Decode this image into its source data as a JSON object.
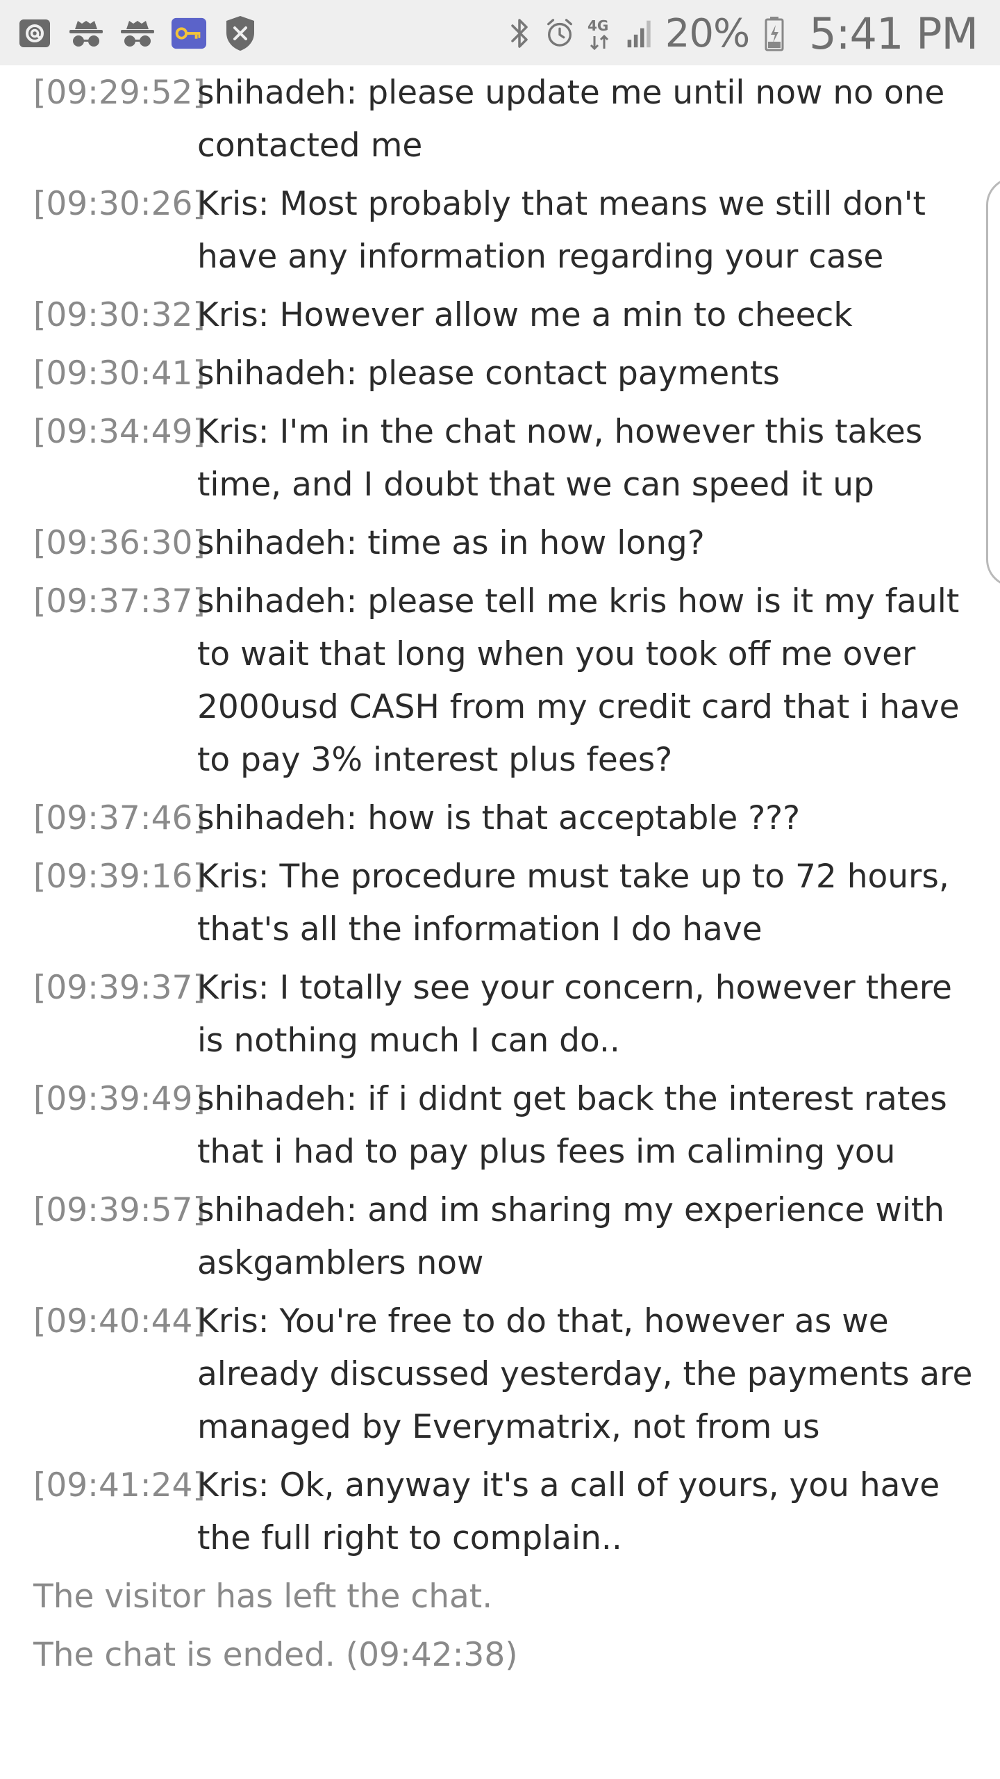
{
  "status_bar": {
    "left_icons": [
      "at-sign-icon",
      "incognito-icon",
      "incognito-icon",
      "key-icon",
      "shield-close-icon"
    ],
    "right_icons": [
      "bluetooth-icon",
      "alarm-icon",
      "network-4g-icon",
      "signal-icon",
      "battery-icon"
    ],
    "battery_percent": "20%",
    "time": "5:41 PM"
  },
  "messages": [
    {
      "ts": "[09:29:52]",
      "text": "shihadeh: please update me until now no one contacted me"
    },
    {
      "ts": "[09:30:26]",
      "text": "Kris: Most probably that means we still don't have any information regarding your case"
    },
    {
      "ts": "[09:30:32]",
      "text": "Kris: However allow me a min to cheeck"
    },
    {
      "ts": "[09:30:41]",
      "text": "shihadeh: please contact payments"
    },
    {
      "ts": "[09:34:49]",
      "text": "Kris: I'm in the chat now, however this takes time, and I doubt that we can speed it up"
    },
    {
      "ts": "[09:36:30]",
      "text": "shihadeh: time as in how long?"
    },
    {
      "ts": "[09:37:37]",
      "text": "shihadeh: please tell me kris how is it my fault to wait that long when you took off me over 2000usd CASH from my credit card that i have to pay 3% interest plus fees?"
    },
    {
      "ts": "[09:37:46]",
      "text": "shihadeh: how is that acceptable ???"
    },
    {
      "ts": "[09:39:16]",
      "text": "Kris: The procedure must take up to 72 hours, that's all the information I do have"
    },
    {
      "ts": "[09:39:37]",
      "text": "Kris: I totally see your concern, however there is nothing much I can do.."
    },
    {
      "ts": "[09:39:49]",
      "text": "shihadeh: if i didnt get back the interest rates that i had to pay plus fees im caliming you"
    },
    {
      "ts": "[09:39:57]",
      "text": "shihadeh: and im sharing my experience with askgamblers now"
    },
    {
      "ts": "[09:40:44]",
      "text": "Kris: You're free to do that, however as we already discussed yesterday, the payments are managed by Everymatrix, not from us"
    },
    {
      "ts": "[09:41:24]",
      "text": "Kris: Ok, anyway it's a call of yours, you have the full right to complain.."
    }
  ],
  "system_messages": [
    "The visitor has left the chat.",
    "The chat is ended. (09:42:38)"
  ],
  "colors": {
    "status_bar_bg": "#efefef",
    "timestamp": "#8a8a8a",
    "message_text": "#2b2b2b",
    "key_icon_bg": "#5b63c9",
    "key_icon_fg": "#f2c33a"
  }
}
